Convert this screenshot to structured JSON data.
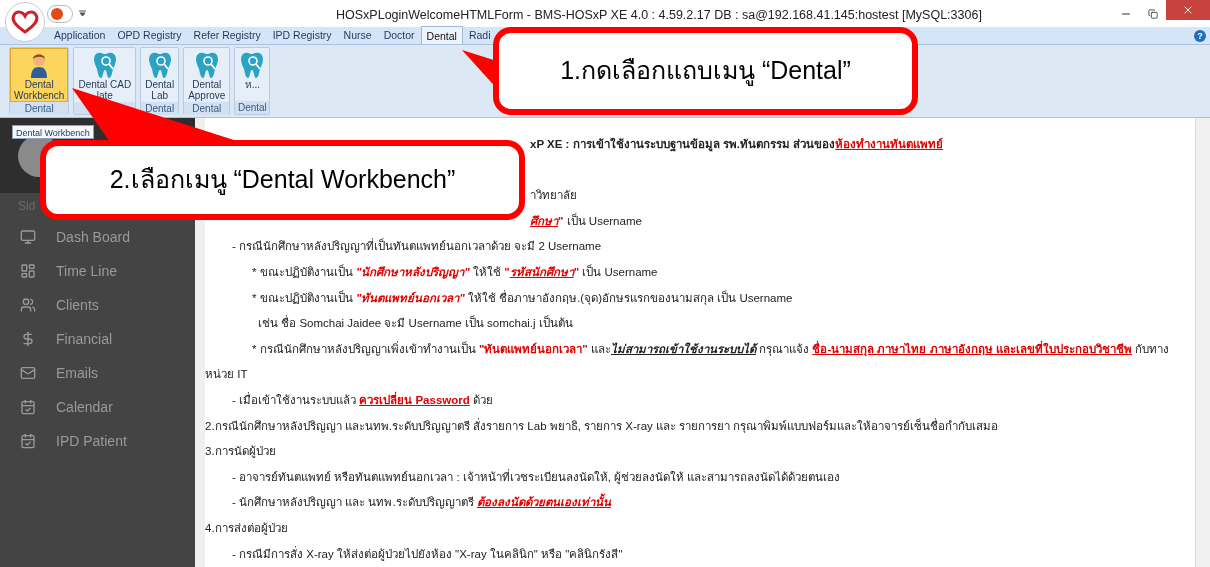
{
  "window": {
    "title": "HOSxPLoginWelcomeHTMLForm - BMS-HOSxP XE 4.0 : 4.59.2.17 DB : sa@192.168.41.145:hostest [MySQL:3306]"
  },
  "ribbon_tabs": [
    {
      "label": "Application",
      "selected": false
    },
    {
      "label": "OPD Registry",
      "selected": false
    },
    {
      "label": "Refer Registry",
      "selected": false
    },
    {
      "label": "IPD Registry",
      "selected": false
    },
    {
      "label": "Nurse",
      "selected": false
    },
    {
      "label": "Doctor",
      "selected": false
    },
    {
      "label": "Dental",
      "selected": true
    },
    {
      "label": "Radi",
      "selected": false
    }
  ],
  "help_button": "?",
  "ribbon_buttons": [
    {
      "lines": [
        "Dental",
        "Workbench"
      ],
      "group": "Dental",
      "selected": true
    },
    {
      "lines": [
        "Dental CAD",
        "late"
      ],
      "selected": false
    },
    {
      "lines": [
        "Dental",
        "Lab"
      ],
      "group": "Dental",
      "selected": false
    },
    {
      "lines": [
        "Dental",
        "Approve"
      ],
      "group": "Dental",
      "selected": false
    },
    {
      "lines": [
        "ห..."
      ],
      "group": "Dental",
      "selected": false
    }
  ],
  "tooltip": "Dental Workbench",
  "sidebar": {
    "heading": "Sid",
    "items": [
      {
        "label": "Dash Board"
      },
      {
        "label": "Time Line"
      },
      {
        "label": "Clients"
      },
      {
        "label": "Financial"
      },
      {
        "label": "Emails"
      },
      {
        "label": "Calendar"
      },
      {
        "label": "IPD Patient"
      }
    ]
  },
  "content": [
    {
      "kind": "heading",
      "parts": [
        {
          "kind": "bold",
          "text": "xP XE : การเข้าใช้งานระบบฐานข้อมูล รพ.ทันตกรรม ส่วนของ"
        },
        {
          "kind": "link",
          "text": "ห้องทำงานทันตแพทย์"
        }
      ]
    },
    {
      "kind": "covered",
      "parts": [
        {
          "kind": "plain",
          "text": "าวิทยาลัย"
        }
      ]
    },
    {
      "kind": "covered",
      "parts": [
        {
          "kind": "red_italic_underline",
          "text": "ศึกษา"
        },
        {
          "kind": "red",
          "text": "\""
        },
        {
          "kind": "plain",
          "text": " เป็น Username"
        }
      ]
    },
    {
      "kind": "dash",
      "parts": [
        {
          "kind": "plain",
          "text": "- กรณีนักศึกษาหลังปริญญาที่เป็นทันตแพทย์นอกเวลาด้วย จะมี 2 Username"
        }
      ]
    },
    {
      "kind": "star",
      "parts": [
        {
          "kind": "plain",
          "text": "* ขณะปฏิบัติงานเป็น "
        },
        {
          "kind": "red_italic",
          "text": "\"นักศึกษาหลังปริญญา\""
        },
        {
          "kind": "plain",
          "text": " ให้ใช้ "
        },
        {
          "kind": "red",
          "text": "\""
        },
        {
          "kind": "red_italic_underline",
          "text": "รหัสนักศึกษา"
        },
        {
          "kind": "red",
          "text": "\""
        },
        {
          "kind": "plain",
          "text": " เป็น Username"
        }
      ]
    },
    {
      "kind": "star",
      "parts": [
        {
          "kind": "plain",
          "text": "* ขณะปฏิบัติงานเป็น "
        },
        {
          "kind": "red_italic",
          "text": "\"ทันตแพทย์นอกเวลา\""
        },
        {
          "kind": "plain",
          "text": " ให้ใช้ ชื่อภาษาอังกฤษ.(จุด)อักษรแรกของนามสกุล เป็น Username"
        }
      ]
    },
    {
      "kind": "example",
      "parts": [
        {
          "kind": "plain",
          "text": "เช่น ชื่อ Somchai Jaidee จะมี Username เป็น somchai.j เป็นต้น"
        }
      ]
    },
    {
      "kind": "star",
      "parts": [
        {
          "kind": "plain",
          "text": "* กรณีนักศึกษาหลังปริญญาเพิ่งเข้าทำงานเป็น "
        },
        {
          "kind": "red",
          "text": "\"ทันตแพทย์นอกเวลา\""
        },
        {
          "kind": "plain",
          "text": " และ"
        },
        {
          "kind": "black_italic_underline",
          "text": "ไม่สามารถเข้าใช้งานระบบได้"
        },
        {
          "kind": "plain",
          "text": " กรุณาแจ้ง "
        },
        {
          "kind": "link",
          "text": "ชื่อ-นามสกุล ภาษาไทย ภาษาอังกฤษ และเลขที่ใบประกอบวิชาชีพ"
        },
        {
          "kind": "plain",
          "text": " กับทาง"
        }
      ]
    },
    {
      "kind": "none",
      "parts": [
        {
          "kind": "plain",
          "text": "หน่วย IT"
        }
      ]
    },
    {
      "kind": "dash",
      "parts": [
        {
          "kind": "plain",
          "text": "- เมื่อเข้าใช้งานระบบแล้ว "
        },
        {
          "kind": "link",
          "text": "ควรเปลี่ยน Password"
        },
        {
          "kind": "plain",
          "text": " ด้วย"
        }
      ]
    },
    {
      "kind": "none",
      "parts": [
        {
          "kind": "plain",
          "text": "2.กรณีนักศึกษาหลังปริญญา และนทพ.ระดับปริญญาตรี สั่งรายการ Lab พยาธิ, รายการ X-ray และ รายการยา กรุณาพิมพ์แบบฟอร์มและให้อาจารย์เซ็นชื่อกำกับเสมอ"
        }
      ]
    },
    {
      "kind": "none",
      "parts": [
        {
          "kind": "plain",
          "text": "3.การนัดผู้ป่วย"
        }
      ]
    },
    {
      "kind": "dash",
      "parts": [
        {
          "kind": "plain",
          "text": "- อาจารย์ทันตแพทย์ หรือทันตแพทย์นอกเวลา : เจ้าหน้าที่เวชระเบียนลงนัดให้, ผู้ช่วยลงนัดให้ และสามารถลงนัดได้ด้วยตนเอง"
        }
      ]
    },
    {
      "kind": "dash",
      "parts": [
        {
          "kind": "plain",
          "text": "- นักศึกษาหลังปริญญา และ นทพ.ระดับปริญญาตรี "
        },
        {
          "kind": "red_italic_underline",
          "text": "ต้องลงนัดด้วยตนเองเท่านั้น"
        }
      ]
    },
    {
      "kind": "none",
      "parts": [
        {
          "kind": "plain",
          "text": "4.การส่งต่อผู้ป่วย"
        }
      ]
    },
    {
      "kind": "dash",
      "parts": [
        {
          "kind": "plain",
          "text": "- กรณีมีการสั่ง X-ray ให้ส่งต่อผู้ป่วยไปยังห้อง \"X-ray ในคลินิก\" หรือ \"คลินิกรังสี\""
        }
      ]
    }
  ],
  "callouts": [
    {
      "text": "1.กดเลือกแถบเมนู “Dental”"
    },
    {
      "text": "2.เลือกเมนู “Dental Workbench”"
    }
  ]
}
